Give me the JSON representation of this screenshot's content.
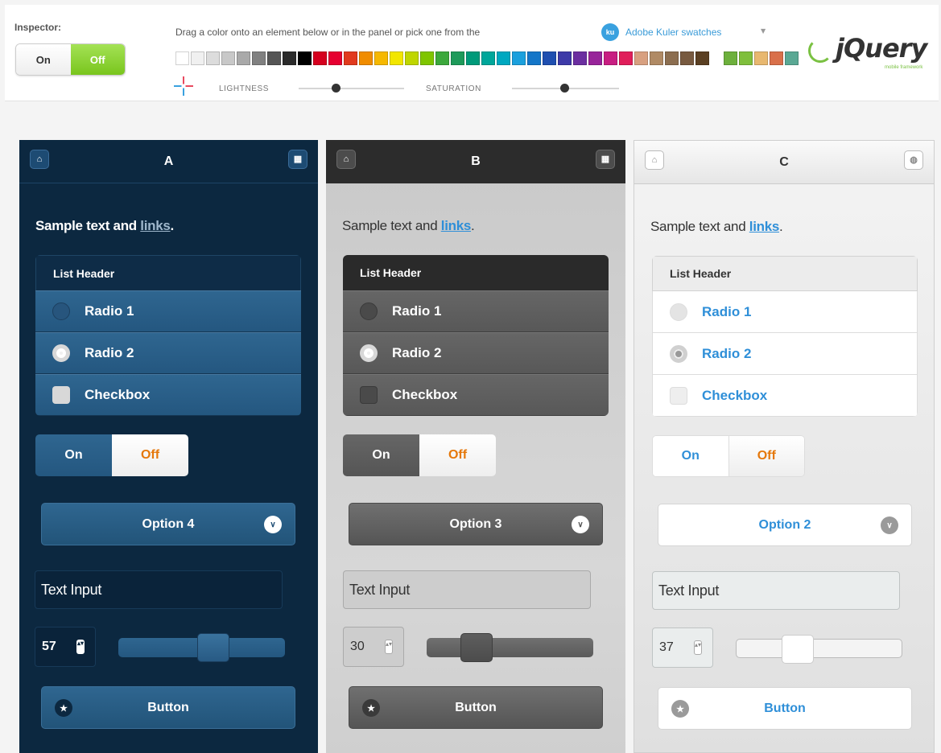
{
  "inspector": {
    "label": "Inspector:",
    "on": "On",
    "off": "Off"
  },
  "swatch_bar": {
    "instruction": "Drag a color onto an element below or in the panel or pick one from the",
    "kuler_icon_text": "ku",
    "kuler_link": "Adobe Kuler swatches",
    "lightness_label": "LIGHTNESS",
    "saturation_label": "SATURATION",
    "lightness_value": 0.35,
    "saturation_value": 0.49,
    "colors": [
      "#ffffff",
      "#f0f0f0",
      "#dcdcdc",
      "#c8c8c8",
      "#a9a9a9",
      "#808080",
      "#555555",
      "#2b2b2b",
      "#000000",
      "#d5001e",
      "#e60030",
      "#e13a1e",
      "#f08c00",
      "#f6b800",
      "#f2e600",
      "#bfd600",
      "#7fc500",
      "#3ca83c",
      "#1e9a5a",
      "#009a7a",
      "#00a69a",
      "#00a8c0",
      "#1ba0dd",
      "#1476c8",
      "#1f4fb0",
      "#3d3aa8",
      "#6b2ea0",
      "#98249a",
      "#c81e82",
      "#e01e5a",
      "#d8a080",
      "#b08a64",
      "#8c6e50",
      "#785a40",
      "#5a3f22",
      "#6db03c",
      "#7fbf3c",
      "#e8b870",
      "#d9704a",
      "#5aa894"
    ],
    "color_gap_index": 34
  },
  "logo": {
    "text": "jQuery",
    "tagline": "mobile framework"
  },
  "icons": {
    "home": "⌂",
    "grid": "▦",
    "globe": "◍",
    "chevron": "∨",
    "spinner": "▴▾",
    "star": "★",
    "check": "✓"
  },
  "panels": [
    {
      "title": "A",
      "sample_text": "Sample text and ",
      "sample_link": "links",
      "sample_end": ".",
      "list_header": "List Header",
      "radio1": "Radio 1",
      "radio2": "Radio 2",
      "checkbox": "Checkbox",
      "toggle_on": "On",
      "toggle_off": "Off",
      "select_value": "Option 4",
      "text_input": "Text Input",
      "number": "57",
      "slider_fraction": 0.57,
      "button": "Button"
    },
    {
      "title": "B",
      "sample_text": "Sample text and ",
      "sample_link": "links",
      "sample_end": ".",
      "list_header": "List Header",
      "radio1": "Radio 1",
      "radio2": "Radio 2",
      "checkbox": "Checkbox",
      "toggle_on": "On",
      "toggle_off": "Off",
      "select_value": "Option 3",
      "text_input": "Text Input",
      "number": "30",
      "slider_fraction": 0.3,
      "button": "Button"
    },
    {
      "title": "C",
      "sample_text": "Sample text and ",
      "sample_link": "links",
      "sample_end": ".",
      "list_header": "List Header",
      "radio1": "Radio 1",
      "radio2": "Radio 2",
      "checkbox": "Checkbox",
      "toggle_on": "On",
      "toggle_off": "Off",
      "select_value": "Option 2",
      "text_input": "Text Input",
      "number": "37",
      "slider_fraction": 0.37,
      "button": "Button"
    }
  ]
}
